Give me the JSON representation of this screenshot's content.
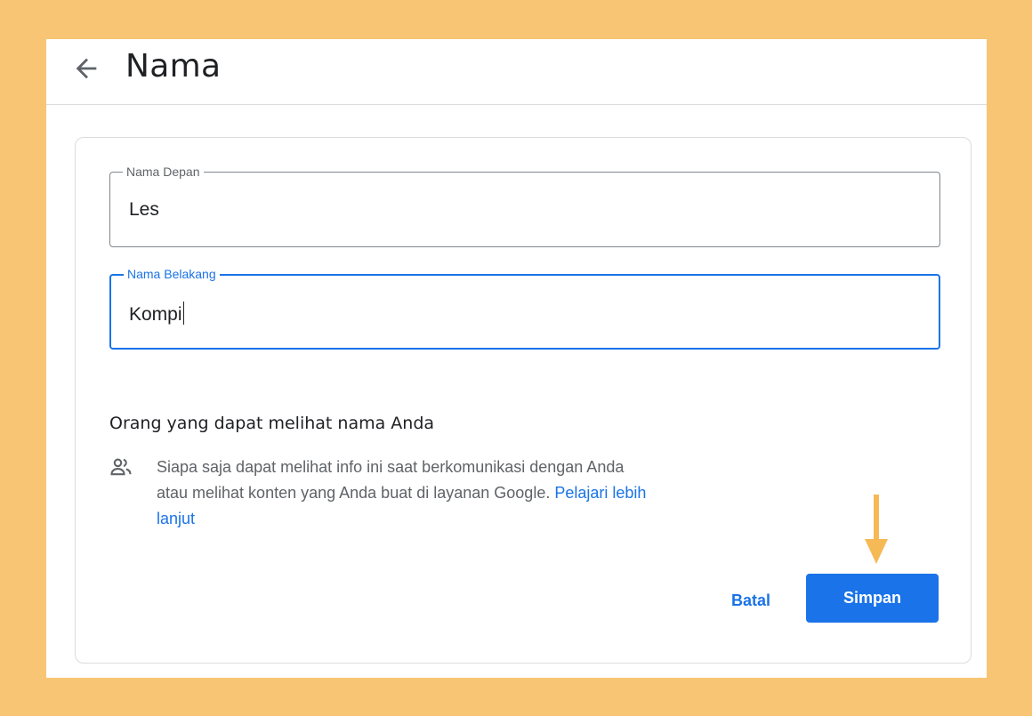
{
  "header": {
    "title": "Nama",
    "back_icon": "arrow-back-icon"
  },
  "form": {
    "first_name": {
      "label": "Nama Depan",
      "value": "Les"
    },
    "last_name": {
      "label": "Nama Belakang",
      "value": "Kompi"
    }
  },
  "visibility": {
    "title": "Orang yang dapat melihat nama Anda",
    "icon": "people-icon",
    "text": "Siapa saja dapat melihat info ini saat berkomunikasi dengan Anda atau melihat konten yang Anda buat di layanan Google.",
    "link": "Pelajari lebih lanjut"
  },
  "actions": {
    "cancel_label": "Batal",
    "save_label": "Simpan"
  },
  "colors": {
    "background": "#f7c574",
    "accent": "#1a73e8",
    "annotation_arrow": "#f5b955"
  }
}
